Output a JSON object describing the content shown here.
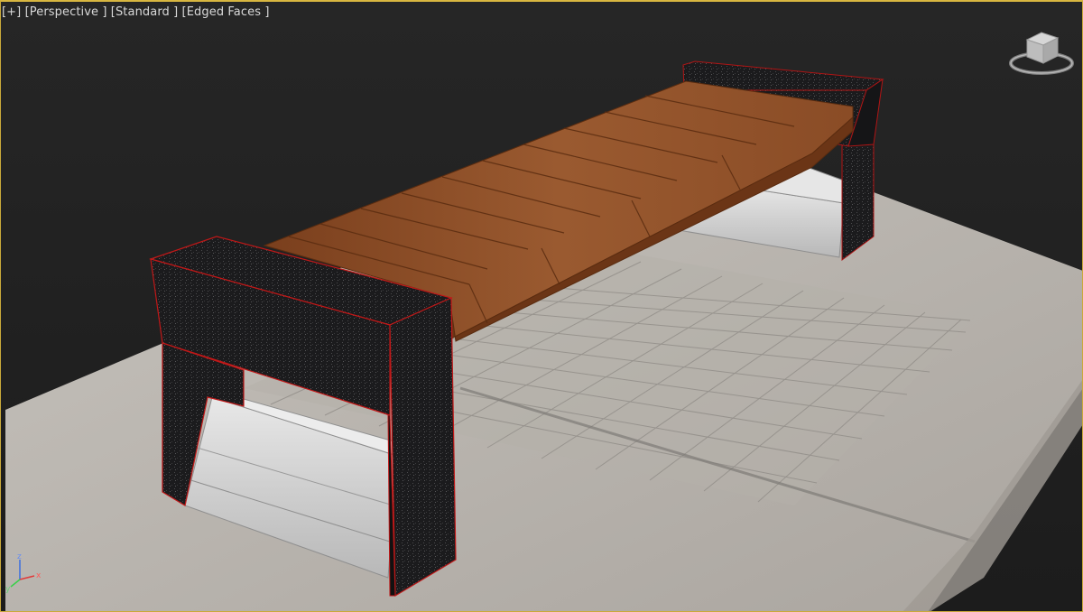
{
  "viewport": {
    "label_plus": "[+]",
    "label_view": "[Perspective ]",
    "label_shading": "[Standard ]",
    "label_edges": "[Edged Faces ]"
  },
  "axis": {
    "x": "x",
    "y": "y",
    "z": "z"
  },
  "colors": {
    "background_top": "#2a2a2a",
    "background_bottom": "#1b1b1b",
    "border": "#d8b640",
    "ground": "#bdb9b3",
    "tile_line": "#8d8a86",
    "granite": "#1c1c1e",
    "wood": "#8a4a22",
    "planter": "#d9d9d9",
    "selection_edge": "#c01818"
  },
  "objects": [
    "bench",
    "ground-plane"
  ]
}
